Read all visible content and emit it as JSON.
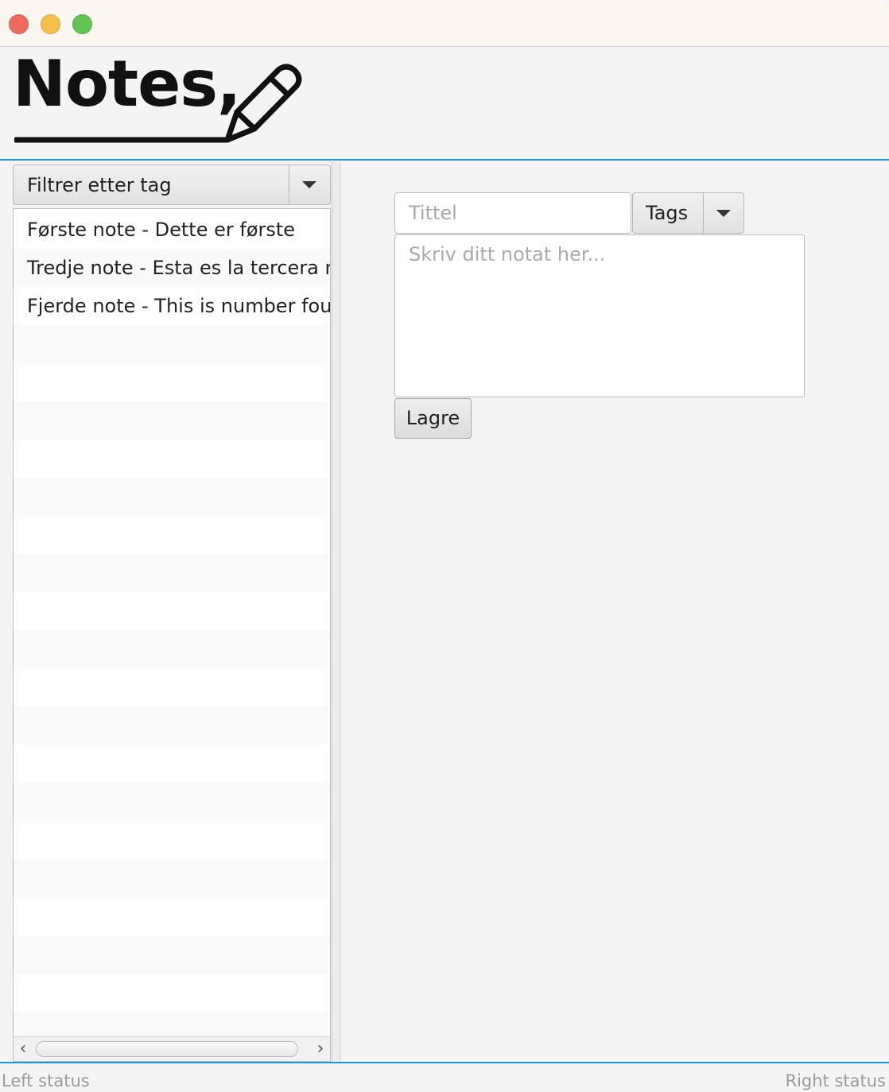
{
  "app": {
    "logo_text": "Notes,"
  },
  "filter": {
    "label": "Filtrer etter tag"
  },
  "notes_list": [
    "Første note - Dette er første",
    "Tredje note - Esta es la tercera nota",
    "Fjerde note - This is number four"
  ],
  "editor": {
    "title_placeholder": "Tittel",
    "tags_label": "Tags",
    "body_placeholder": "Skriv ditt notat her...",
    "save_label": "Lagre"
  },
  "status": {
    "left": "Left status",
    "right": "Right status"
  },
  "colors": {
    "accent": "#1d97d8",
    "close": "#ee6a5f",
    "minimize": "#f5be4f",
    "zoom": "#62c655"
  },
  "icons": {
    "logo": "pencil-icon",
    "dropdown": "chevron-down-icon",
    "scroll_left": "chevron-left-icon",
    "scroll_right": "chevron-right-icon"
  }
}
